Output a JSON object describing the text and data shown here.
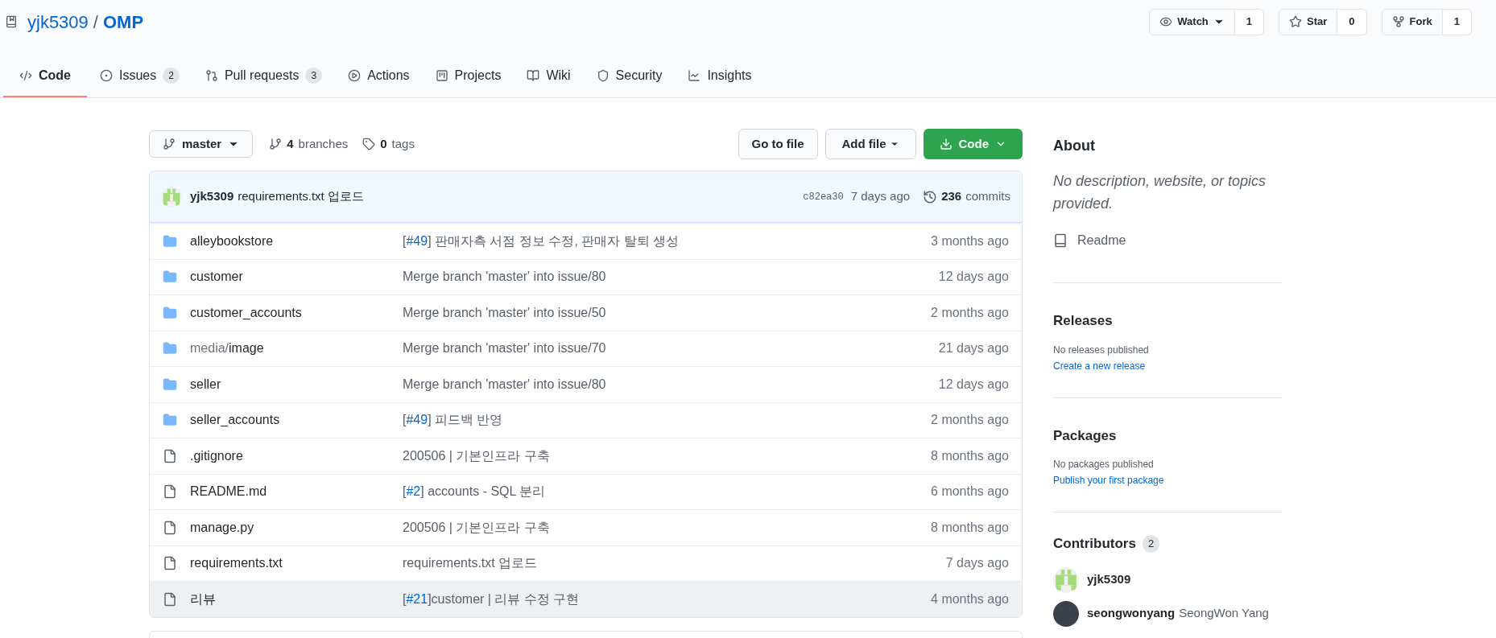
{
  "repo": {
    "owner": "yjk5309",
    "separator": "/",
    "name": "OMP"
  },
  "repo_actions": [
    {
      "kind": "watch",
      "label": "Watch",
      "count": "1"
    },
    {
      "kind": "star",
      "label": "Star",
      "count": "0"
    },
    {
      "kind": "fork",
      "label": "Fork",
      "count": "1"
    }
  ],
  "tabs": [
    {
      "kind": "code",
      "label": "Code",
      "selected": true
    },
    {
      "kind": "issues",
      "label": "Issues",
      "count": "2",
      "selected": false
    },
    {
      "kind": "pulls",
      "label": "Pull requests",
      "count": "3",
      "selected": false
    },
    {
      "kind": "actions",
      "label": "Actions",
      "selected": false
    },
    {
      "kind": "projects",
      "label": "Projects",
      "selected": false
    },
    {
      "kind": "wiki",
      "label": "Wiki",
      "selected": false
    },
    {
      "kind": "security",
      "label": "Security",
      "selected": false
    },
    {
      "kind": "insights",
      "label": "Insights",
      "selected": false
    }
  ],
  "toolbar": {
    "branch": "master",
    "branches_count": "4",
    "branches_label": "branches",
    "tags_count": "0",
    "tags_label": "tags",
    "go_to_file": "Go to file",
    "add_file": "Add file",
    "code": "Code"
  },
  "latest_commit": {
    "author": "yjk5309",
    "message": "requirements.txt 업로드",
    "sha": "c82ea30",
    "time": "7 days ago",
    "commits_count": "236",
    "commits_label": "commits"
  },
  "files": [
    {
      "kind": "dir",
      "name": "alleybookstore",
      "message": {
        "before": "[",
        "link": "#49",
        "after": "] 판매자측 서점 정보 수정, 판매자 탈퇴 생성"
      },
      "time": "3 months ago",
      "hovered": false
    },
    {
      "kind": "dir",
      "name": "customer",
      "message": {
        "after": "Merge branch 'master' into issue/80"
      },
      "time": "12 days ago",
      "hovered": false
    },
    {
      "kind": "dir",
      "name": "customer_accounts",
      "message": {
        "after": "Merge branch 'master' into issue/50"
      },
      "time": "2 months ago",
      "hovered": false
    },
    {
      "kind": "dir",
      "prefix": "media/",
      "name": "image",
      "message": {
        "after": "Merge branch 'master' into issue/70"
      },
      "time": "21 days ago",
      "hovered": false
    },
    {
      "kind": "dir",
      "name": "seller",
      "message": {
        "after": "Merge branch 'master' into issue/80"
      },
      "time": "12 days ago",
      "hovered": false
    },
    {
      "kind": "dir",
      "name": "seller_accounts",
      "message": {
        "before": "[",
        "link": "#49",
        "after": "] 피드백 반영"
      },
      "time": "2 months ago",
      "hovered": false
    },
    {
      "kind": "file",
      "name": ".gitignore",
      "message": {
        "after": "200506 | 기본인프라 구축"
      },
      "time": "8 months ago",
      "hovered": false
    },
    {
      "kind": "file",
      "name": "README.md",
      "message": {
        "before": "[",
        "link": "#2",
        "after": "] accounts - SQL 분리"
      },
      "time": "6 months ago",
      "hovered": false
    },
    {
      "kind": "file",
      "name": "manage.py",
      "message": {
        "after": "200506 | 기본인프라 구축"
      },
      "time": "8 months ago",
      "hovered": false
    },
    {
      "kind": "file",
      "name": "requirements.txt",
      "message": {
        "after": "requirements.txt 업로드"
      },
      "time": "7 days ago",
      "hovered": false
    },
    {
      "kind": "file",
      "name": "리뷰",
      "message": {
        "before": "[",
        "link": "#21",
        "after": "]customer | 리뷰 수정 구현"
      },
      "time": "4 months ago",
      "hovered": true
    }
  ],
  "sidebar": {
    "about": {
      "title": "About",
      "description": "No description, website, or topics provided.",
      "readme": "Readme"
    },
    "releases": {
      "title": "Releases",
      "empty": "No releases published",
      "link": "Create a new release"
    },
    "packages": {
      "title": "Packages",
      "empty": "No packages published",
      "link": "Publish your first package"
    },
    "contributors": {
      "title": "Contributors",
      "count": "2",
      "people": [
        {
          "kind": "identicon",
          "login": "yjk5309"
        },
        {
          "kind": "photo",
          "login": "seongwonyang",
          "name": "SeongWon Yang"
        }
      ]
    }
  }
}
